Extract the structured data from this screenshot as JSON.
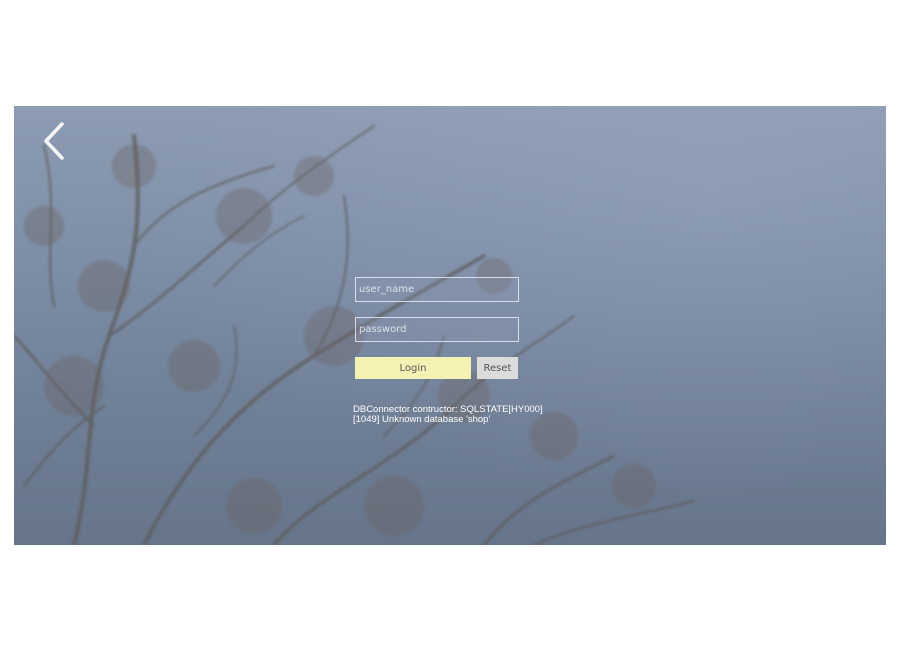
{
  "background": {
    "image": "blurred-tree-branches-against-sky"
  },
  "nav": {
    "back_icon": "chevron-left-icon"
  },
  "login_form": {
    "username_placeholder": "user_name",
    "password_placeholder": "password",
    "login_label": "Login",
    "reset_label": "Reset"
  },
  "error": {
    "line1": "DBConnector contructor: SQLSTATE[HY000]",
    "line2": "[1049] Unknown database 'shop'"
  },
  "colors": {
    "login_button": "#f5f1b5",
    "reset_button": "#dcdcdc",
    "error_text": "#ffffff"
  }
}
